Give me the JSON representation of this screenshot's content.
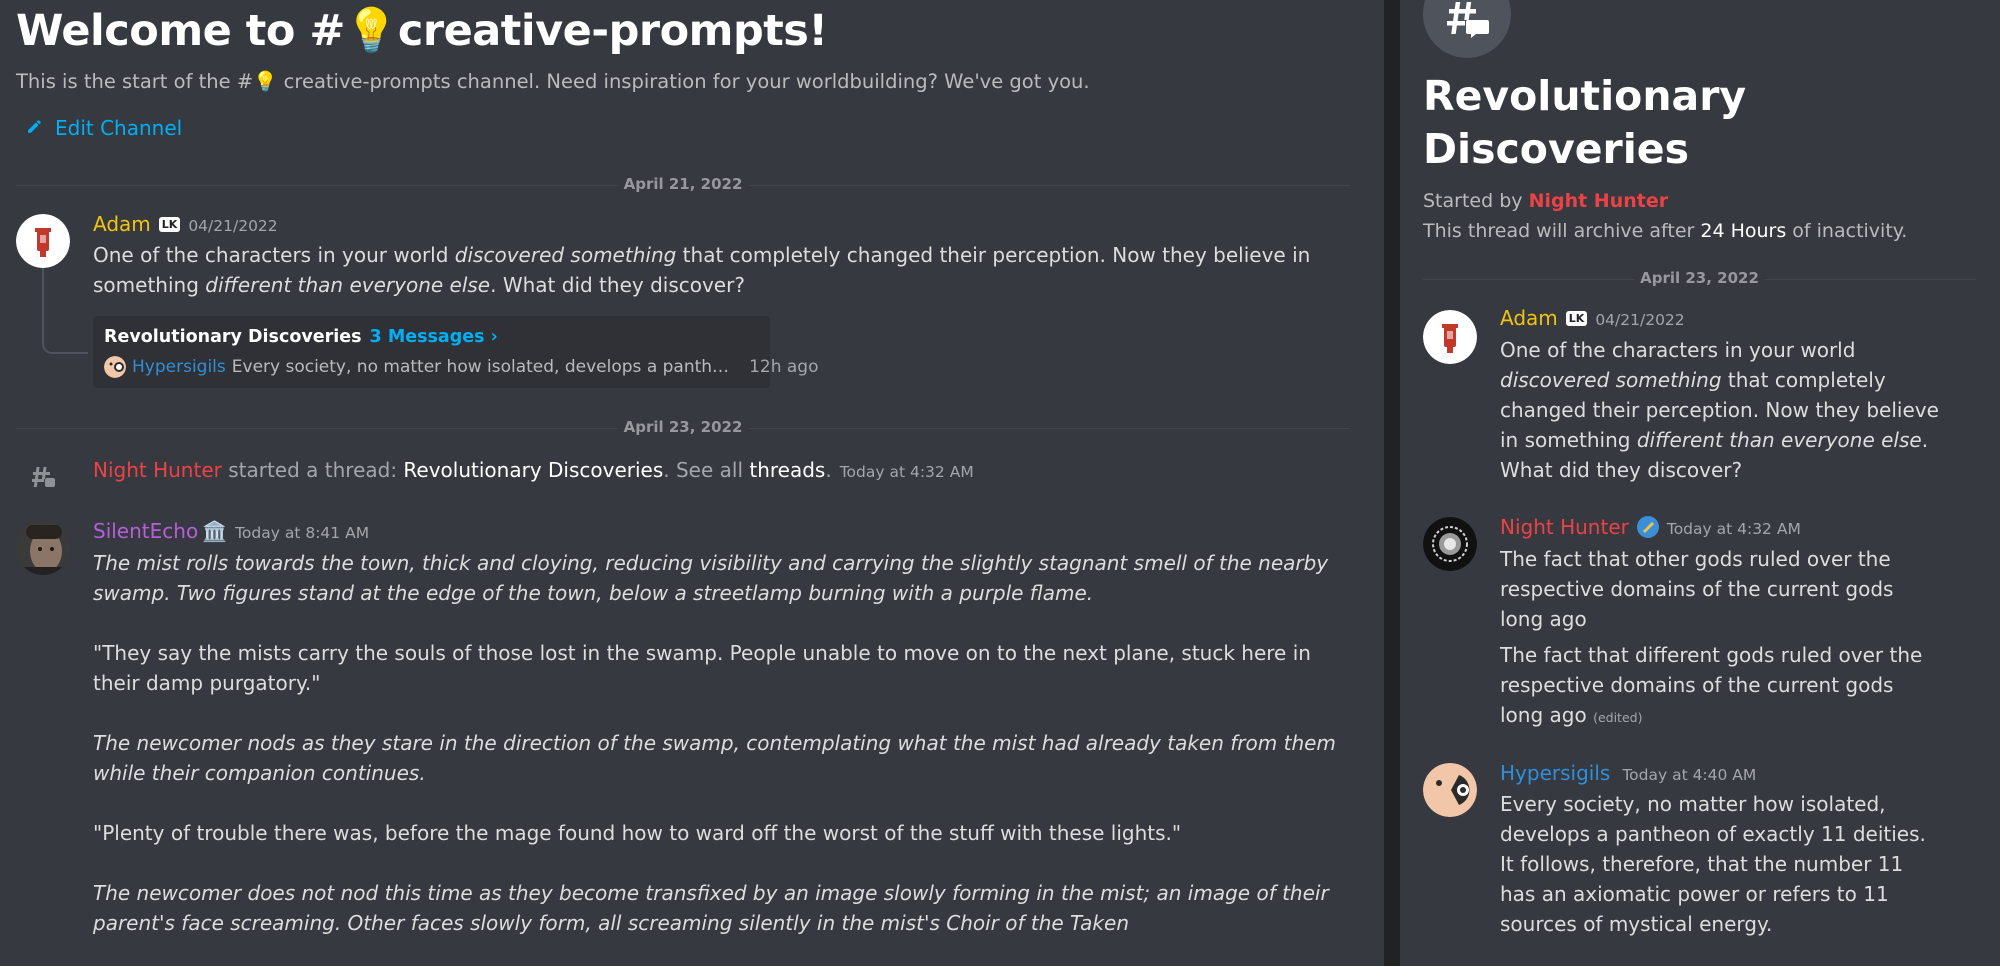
{
  "channel": {
    "welcome_title": "Welcome to #💡creative-prompts!",
    "welcome_subtitle": "This is the start of the #💡 creative-prompts channel. Need inspiration for your worldbuilding? We've got you.",
    "edit_channel_label": "Edit Channel"
  },
  "dividers": {
    "date1": "April 21, 2022",
    "date2": "April 23, 2022"
  },
  "message_adam": {
    "author": "Adam",
    "badge": "LK",
    "timestamp": "04/21/2022",
    "text_1": "One of the characters in your world ",
    "text_2_italic": "discovered something",
    "text_3": " that completely changed their perception. Now they believe in something ",
    "text_4_italic": "different than everyone else",
    "text_5": ". What did they discover?"
  },
  "thread_card": {
    "name": "Revolutionary Discoveries",
    "count": "3 Messages ›",
    "last_author": "Hypersigils",
    "last_preview": "Every society, no matter how isolated, develops a panth…",
    "last_time": "12h ago"
  },
  "system_message": {
    "author": "Night Hunter",
    "action": " started a thread: ",
    "thread_name": "Revolutionary Discoveries",
    "see_all": ". See all ",
    "threads_link": "threads",
    "end": ".",
    "timestamp": "Today at 4:32 AM"
  },
  "message_silentecho": {
    "author": "SilentEcho",
    "emoji": "🏛️",
    "timestamp": "Today at 8:41 AM",
    "p1": "The mist rolls towards the town, thick and cloying, reducing visibility and carrying the slightly stagnant smell of the nearby swamp. Two figures stand at the edge of the town, below a streetlamp burning with a purple flame.",
    "p2": "\"They say the mists carry the souls of those lost in the swamp. People unable to move on to the next plane, stuck here in their damp purgatory.\"",
    "p3": "The newcomer nods as they stare in the direction of the swamp, contemplating what the mist had already taken from them while their companion continues.",
    "p4": "\"Plenty of trouble there was, before the mage found how to ward off the worst of the stuff with these lights.\"",
    "p5": "The newcomer does not nod this time as they become transfixed by an image slowly forming in the mist; an image of their parent's face screaming. Other faces slowly form, all screaming silently in the mist's Choir of the Taken"
  },
  "thread_panel": {
    "title": "Revolutionary Discoveries",
    "started_by_prefix": "Started by ",
    "started_by_name": "Night Hunter",
    "archive_prefix": "This thread will archive after ",
    "archive_hours": "24 Hours",
    "archive_suffix": " of inactivity.",
    "date": "April 23, 2022",
    "msg1": {
      "author": "Adam",
      "badge": "LK",
      "timestamp": "04/21/2022",
      "text_1": "One of the characters in your world ",
      "text_2_italic": "discovered something",
      "text_3": " that completely changed their perception. Now they believe in something ",
      "text_4_italic": "different than everyone else",
      "text_5": ". What did they discover?"
    },
    "msg2": {
      "author": "Night Hunter",
      "timestamp": "Today at 4:32 AM",
      "text_a": "The fact that other gods ruled over the respective domains of the current gods long ago",
      "text_b": "The fact that different gods ruled over the respective domains of the current gods long ago",
      "edited": "(edited)"
    },
    "msg3": {
      "author": "Hypersigils",
      "timestamp": "Today at 4:40 AM",
      "text": "Every society, no matter how isolated, develops a pantheon of exactly 11 deities. It follows, therefore, that the number 11 has an axiomatic power or refers to 11 sources of mystical energy."
    }
  },
  "colors": {
    "background": "#36393f",
    "adam": "#f1c40f",
    "night_hunter": "#ed4245",
    "silentecho": "#b65fd8",
    "hypersigils": "#2f8fd8",
    "link": "#00aff4"
  },
  "icons": {
    "edit": "pencil-icon",
    "thread": "thread-icon",
    "chevron": "chevron-right-icon"
  }
}
